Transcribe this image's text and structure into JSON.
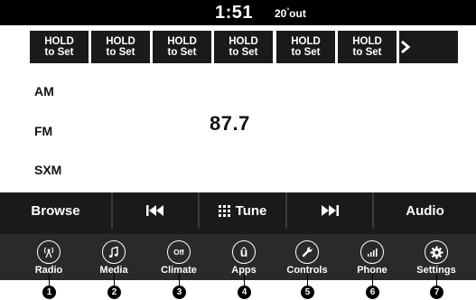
{
  "status": {
    "time": "1:51",
    "temp": "20",
    "temp_degree": "°",
    "temp_unit": "out"
  },
  "presets": [
    {
      "line1": "HOLD",
      "line2": "to Set"
    },
    {
      "line1": "HOLD",
      "line2": "to Set"
    },
    {
      "line1": "HOLD",
      "line2": "to Set"
    },
    {
      "line1": "HOLD",
      "line2": "to Set"
    },
    {
      "line1": "HOLD",
      "line2": "to Set"
    },
    {
      "line1": "HOLD",
      "line2": "to Set"
    }
  ],
  "presets_next": "›",
  "bands": [
    "AM",
    "FM",
    "SXM"
  ],
  "frequency": "87.7",
  "softkeys": {
    "browse": "Browse",
    "prev": "⏮",
    "tune_icon": "⋮⋮",
    "tune": "Tune",
    "next": "⏭",
    "audio": "Audio"
  },
  "dock": [
    {
      "label": "Radio",
      "icon": "radio-icon"
    },
    {
      "label": "Media",
      "icon": "music-note-icon"
    },
    {
      "label": "Climate",
      "icon": "climate-off-icon",
      "icon_text": "Off"
    },
    {
      "label": "Apps",
      "icon": "uconnect-apps-icon",
      "icon_text": "û"
    },
    {
      "label": "Controls",
      "icon": "wrench-icon"
    },
    {
      "label": "Phone",
      "icon": "phone-signal-icon"
    },
    {
      "label": "Settings",
      "icon": "gear-icon"
    }
  ],
  "callouts": [
    "1",
    "2",
    "3",
    "4",
    "5",
    "6",
    "7"
  ]
}
